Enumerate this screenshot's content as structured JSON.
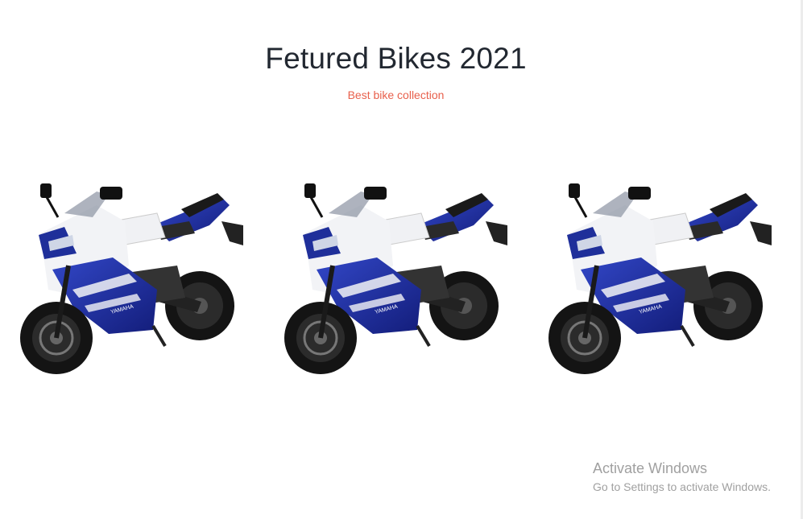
{
  "section": {
    "title": "Fetured Bikes 2021",
    "subtitle": "Best bike collection"
  },
  "bikes": [
    {
      "image": "yamaha-r15-blue-white-motorcycle",
      "brand_text": "YAMAHA"
    },
    {
      "image": "yamaha-r15-blue-white-motorcycle",
      "brand_text": "YAMAHA"
    },
    {
      "image": "yamaha-r15-blue-white-motorcycle",
      "brand_text": "YAMAHA"
    }
  ],
  "colors": {
    "title": "#222831",
    "subtitle": "#e8604c",
    "bike_blue": "#1f2f9a",
    "bike_white": "#f2f3f6",
    "tire": "#141414"
  },
  "watermark": {
    "title": "Activate Windows",
    "subtitle": "Go to Settings to activate Windows."
  }
}
